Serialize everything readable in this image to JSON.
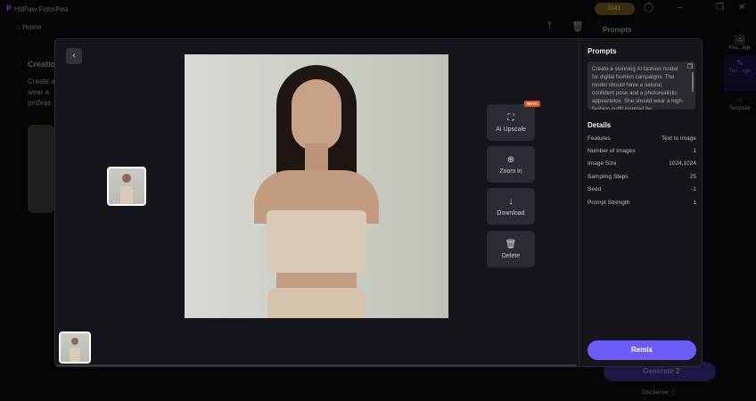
{
  "app": {
    "title": "HitPaw FotorPea",
    "coins": "3341",
    "home": "Home",
    "bg_prompts": "Prompts",
    "creation": "Creation",
    "creation_text": [
      "Create a",
      "wear a",
      "profess"
    ],
    "generate": "Generate",
    "generate_cost": "2",
    "disclaimer": "Disclaimer",
    "sidebar": [
      "Ima...age",
      "Tex...age",
      "Template"
    ]
  },
  "viewer": {
    "actions": [
      {
        "label": "AI Upscale",
        "icon": "upscale-icon",
        "badge": "BETA"
      },
      {
        "label": "Zoom in",
        "icon": "zoom-in-icon"
      },
      {
        "label": "Download",
        "icon": "download-icon"
      },
      {
        "label": "Delete",
        "icon": "trash-icon"
      }
    ]
  },
  "panel": {
    "prompts_title": "Prompts",
    "prompt": "Create a stunning AI fashion model for digital fashion campaigns. The model should have a natural, confident pose and a photorealistic appearance. She should wear a high-fashion outfit inspired by",
    "details_title": "Details",
    "details": [
      {
        "k": "Features",
        "v": "Text to Image"
      },
      {
        "k": "Number of Images",
        "v": "1"
      },
      {
        "k": "Image Size",
        "v": "1024,1024"
      },
      {
        "k": "Sampling Steps",
        "v": "25"
      },
      {
        "k": "Seed",
        "v": "-1"
      },
      {
        "k": "Prompt Strength",
        "v": "1"
      }
    ],
    "remix": "Remix"
  },
  "colors": {
    "accent": "#6c5cf6",
    "beta": "#e0531f"
  }
}
